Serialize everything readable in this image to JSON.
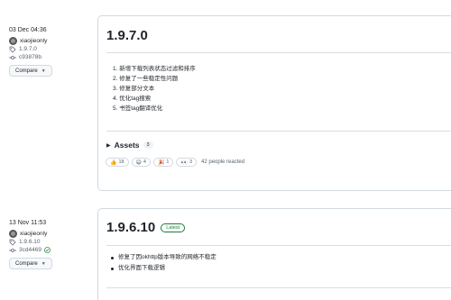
{
  "releases": [
    {
      "date": "03 Dec 04:36",
      "author": "xiaojieonly",
      "tag": "1.9.7.0",
      "commit": "c93878b",
      "compare_label": "Compare",
      "title": "1.9.7.0",
      "latest_label": "",
      "notes": [
        "1. 新增下载列表状态过滤和排序",
        "2. 修复了一些稳定性问题",
        "3. 修复部分文本",
        "4. 优化tag搜索",
        "5. 书签tag翻译优化"
      ],
      "assets_label": "Assets",
      "assets_count": "3",
      "reactions": [
        {
          "emoji_icon": "thumbs-up-icon",
          "glyph": "👍",
          "count": "18"
        },
        {
          "emoji_icon": "smile-icon",
          "glyph": "😄",
          "count": "4"
        },
        {
          "emoji_icon": "tada-icon",
          "glyph": "🎉",
          "count": "1"
        },
        {
          "emoji_icon": "eyes-icon",
          "glyph": "👀",
          "count": "3"
        }
      ],
      "reacted_text": "42 people reacted"
    },
    {
      "date": "13 Nov 11:53",
      "author": "xiaojieonly",
      "tag": "1.9.6.10",
      "commit": "3cd4469",
      "compare_label": "Compare",
      "title": "1.9.6.10",
      "latest_label": "Latest",
      "notes": [
        "修复了因okhttp版本导致的网络不稳定",
        "优化界面下载逻辑"
      ]
    }
  ],
  "colors": {
    "border": "#d1d9e0",
    "muted": "#59636e",
    "latest_green": "#1a7f37"
  }
}
